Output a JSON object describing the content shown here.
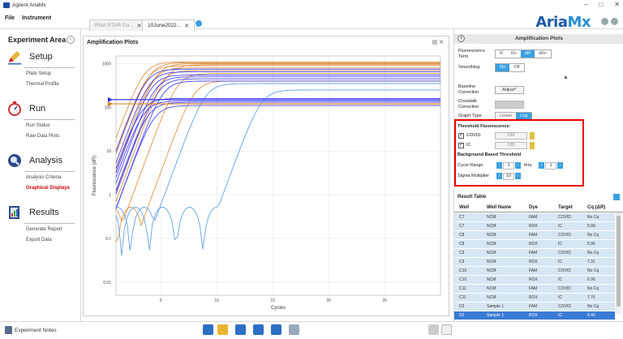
{
  "window": {
    "title": "Agilent AriaMx"
  },
  "menu": {
    "file": "File",
    "instrument": "Instrument"
  },
  "tabs": [
    {
      "label": "RNA STAR Co...",
      "active": false
    },
    {
      "label": "10June2022...",
      "active": true
    }
  ],
  "brand": {
    "left": "Aria",
    "right": "Mx"
  },
  "sidebar": {
    "title": "Experiment Area",
    "sections": [
      {
        "label": "Setup",
        "items": [
          "Plate Setup",
          "Thermal Profile"
        ]
      },
      {
        "label": "Run",
        "items": [
          "Run Status",
          "Raw Data Plots"
        ]
      },
      {
        "label": "Analysis",
        "items": [
          "Analysis Criteria",
          "Graphical Displays"
        ]
      },
      {
        "label": "Results",
        "items": [
          "Generate Report",
          "Export Data"
        ]
      }
    ]
  },
  "footer": {
    "experiment_notes": "Experiment Notes"
  },
  "plot": {
    "title": "Amplification Plots",
    "xlabel": "Cycles",
    "ylabel": "Fluorescence (dR)",
    "x_ticks": [
      "5",
      "10",
      "15",
      "20",
      "25"
    ],
    "y_ticks": [
      "1000",
      "100",
      "10",
      "1",
      "0.1",
      "0.01"
    ]
  },
  "chart_data": {
    "type": "line",
    "xlabel": "Cycles",
    "ylabel": "Fluorescence (dR)",
    "xlim": [
      1,
      30
    ],
    "ylim": [
      0.005,
      1500
    ],
    "y_scale": "log",
    "grid": true,
    "thresholds": [
      {
        "target": "COVID",
        "value": 150,
        "color": "#2a2aff"
      },
      {
        "target": "IC",
        "value": 120,
        "color": "#d9832a"
      }
    ],
    "series": [
      {
        "color": "#d9832a",
        "cq": 3.5,
        "plateau": 1100
      },
      {
        "color": "#d9832a",
        "cq": 3.8,
        "plateau": 900
      },
      {
        "color": "#d9832a",
        "cq": 4.0,
        "plateau": 1050
      },
      {
        "color": "#d9832a",
        "cq": 4.3,
        "plateau": 800
      },
      {
        "color": "#d9832a",
        "cq": 4.6,
        "plateau": 1000
      },
      {
        "color": "#d9832a",
        "cq": 5.0,
        "plateau": 700
      },
      {
        "color": "#d9832a",
        "cq": 5.5,
        "plateau": 950
      },
      {
        "color": "#d9832a",
        "cq": 6.5,
        "plateau": 600
      },
      {
        "color": "#d9832a",
        "cq": 8.0,
        "plateau": 400
      },
      {
        "color": "#2a2aff",
        "cq": 3.7,
        "plateau": 750
      },
      {
        "color": "#2a2aff",
        "cq": 4.0,
        "plateau": 650
      },
      {
        "color": "#2a2aff",
        "cq": 4.2,
        "plateau": 550
      },
      {
        "color": "#2a2aff",
        "cq": 4.5,
        "plateau": 500
      },
      {
        "color": "#2a2aff",
        "cq": 4.8,
        "plateau": 450
      },
      {
        "color": "#2a2aff",
        "cq": 5.2,
        "plateau": 400
      },
      {
        "color": "#2a2aff",
        "cq": 3.3,
        "plateau": 160
      },
      {
        "color": "#2a2aff",
        "cq": 3.5,
        "plateau": 140
      },
      {
        "color": "#2a2aff",
        "cq": 3.9,
        "plateau": 130
      },
      {
        "color": "#2a2aff",
        "cq": 4.4,
        "plateau": 110
      },
      {
        "color": "#4a90e2",
        "cq": 9.0,
        "plateau": 350
      },
      {
        "color": "#4a90e2",
        "cq": 14.0,
        "plateau": 250
      }
    ]
  },
  "settings": {
    "header": "Amplification Plots",
    "fluorescence_term_label": "Fluorescence Term",
    "fluorescence_options": [
      "R",
      "Rn",
      "dR",
      "dRn"
    ],
    "fluorescence_selected": "dR",
    "smoothing_label": "Smoothing",
    "smoothing_options": [
      "On",
      "Off"
    ],
    "smoothing_selected": "On",
    "baseline_label": "Baseline Correction",
    "adjust_label": "Adjust*",
    "crosstalk_label": "Crosstalk Correction",
    "graph_type_label": "Graph Type",
    "graph_type_options": [
      "Linear",
      "Log"
    ],
    "graph_type_selected": "Log",
    "threshold_title": "Threshold Fluorescence:",
    "thresholds": [
      {
        "label": "COVID",
        "value": "150"
      },
      {
        "label": "IC",
        "value": "120"
      }
    ],
    "bg_threshold_title": "Background Based Threshold",
    "cycle_range_label": "Cycle Range",
    "cycle_from": "1",
    "thru_label": "thru",
    "cycle_to": "1",
    "sigma_label": "Sigma Multiplier",
    "sigma_value": "10"
  },
  "result_table": {
    "title": "Result Table",
    "columns": [
      "Well",
      "Well Name",
      "Dye",
      "Target",
      "Cq (ΔR)"
    ],
    "rows": [
      [
        "C7",
        "NCM",
        "FAM",
        "COVID",
        "No Cq"
      ],
      [
        "C7",
        "NCM",
        "ROX",
        "IC",
        "5.99"
      ],
      [
        "C8",
        "NCM",
        "FAM",
        "COVID",
        "No Cq"
      ],
      [
        "C8",
        "NCM",
        "ROX",
        "IC",
        "5.96"
      ],
      [
        "C9",
        "NCM",
        "FAM",
        "COVID",
        "No Cq"
      ],
      [
        "C9",
        "NCM",
        "ROX",
        "IC",
        "7.31"
      ],
      [
        "C10",
        "NCM",
        "FAM",
        "COVID",
        "No Cq"
      ],
      [
        "C10",
        "NCM",
        "ROX",
        "IC",
        "6.96"
      ],
      [
        "C11",
        "NCM",
        "FAM",
        "COVID",
        "No Cq"
      ],
      [
        "C11",
        "NCM",
        "ROX",
        "IC",
        "7.76"
      ],
      [
        "D2",
        "Sample 1",
        "FAM",
        "COVID",
        "No Cq"
      ],
      [
        "D2",
        "Sample 1",
        "ROX",
        "IC",
        "9.40"
      ]
    ],
    "selected_row": 11
  }
}
